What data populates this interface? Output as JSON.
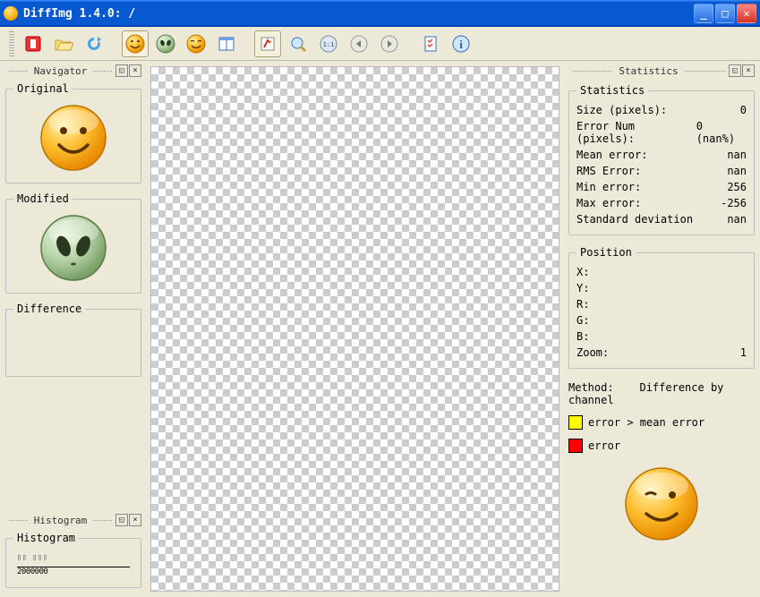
{
  "window": {
    "title": "DiffImg 1.4.0: /"
  },
  "toolbar": {
    "quit": "quit",
    "open": "open",
    "refresh": "refresh",
    "smiley_o": "original-smiley",
    "alien": "modified-alien",
    "smiley_w": "diff-smiley",
    "dual": "dual-panel",
    "highlight": "highlight",
    "zoom": "zoom",
    "fit": "1:1",
    "prev": "prev",
    "next": "next",
    "prefs": "preferences",
    "about": "about"
  },
  "navigator": {
    "panel_title": "Navigator",
    "original_label": "Original",
    "modified_label": "Modified",
    "difference_label": "Difference"
  },
  "histogram": {
    "panel_title": "Histogram",
    "group_label": "Histogram",
    "axis_text": "2000000"
  },
  "statistics": {
    "panel_title": "Statistics",
    "group_label": "Statistics",
    "rows": {
      "size_label": "Size (pixels):",
      "size_val": "0",
      "err_label": "Error Num (pixels):",
      "err_val": "0 (nan%)",
      "mean_label": "Mean error:",
      "mean_val": "nan",
      "rms_label": "RMS Error:",
      "rms_val": "nan",
      "min_label": "Min error:",
      "min_val": "256",
      "max_label": "Max error:",
      "max_val": "-256",
      "std_label": "Standard deviation",
      "std_val": "nan"
    }
  },
  "position": {
    "group_label": "Position",
    "x": "X:",
    "y": "Y:",
    "r": "R:",
    "g": "G:",
    "b": "B:",
    "zoom_label": "Zoom:",
    "zoom_val": "1"
  },
  "method": {
    "label": "Method:",
    "value": "Difference by channel",
    "legend1_text": "error > mean error",
    "legend1_color": "#ffff00",
    "legend2_text": "error",
    "legend2_color": "#ff0000"
  }
}
